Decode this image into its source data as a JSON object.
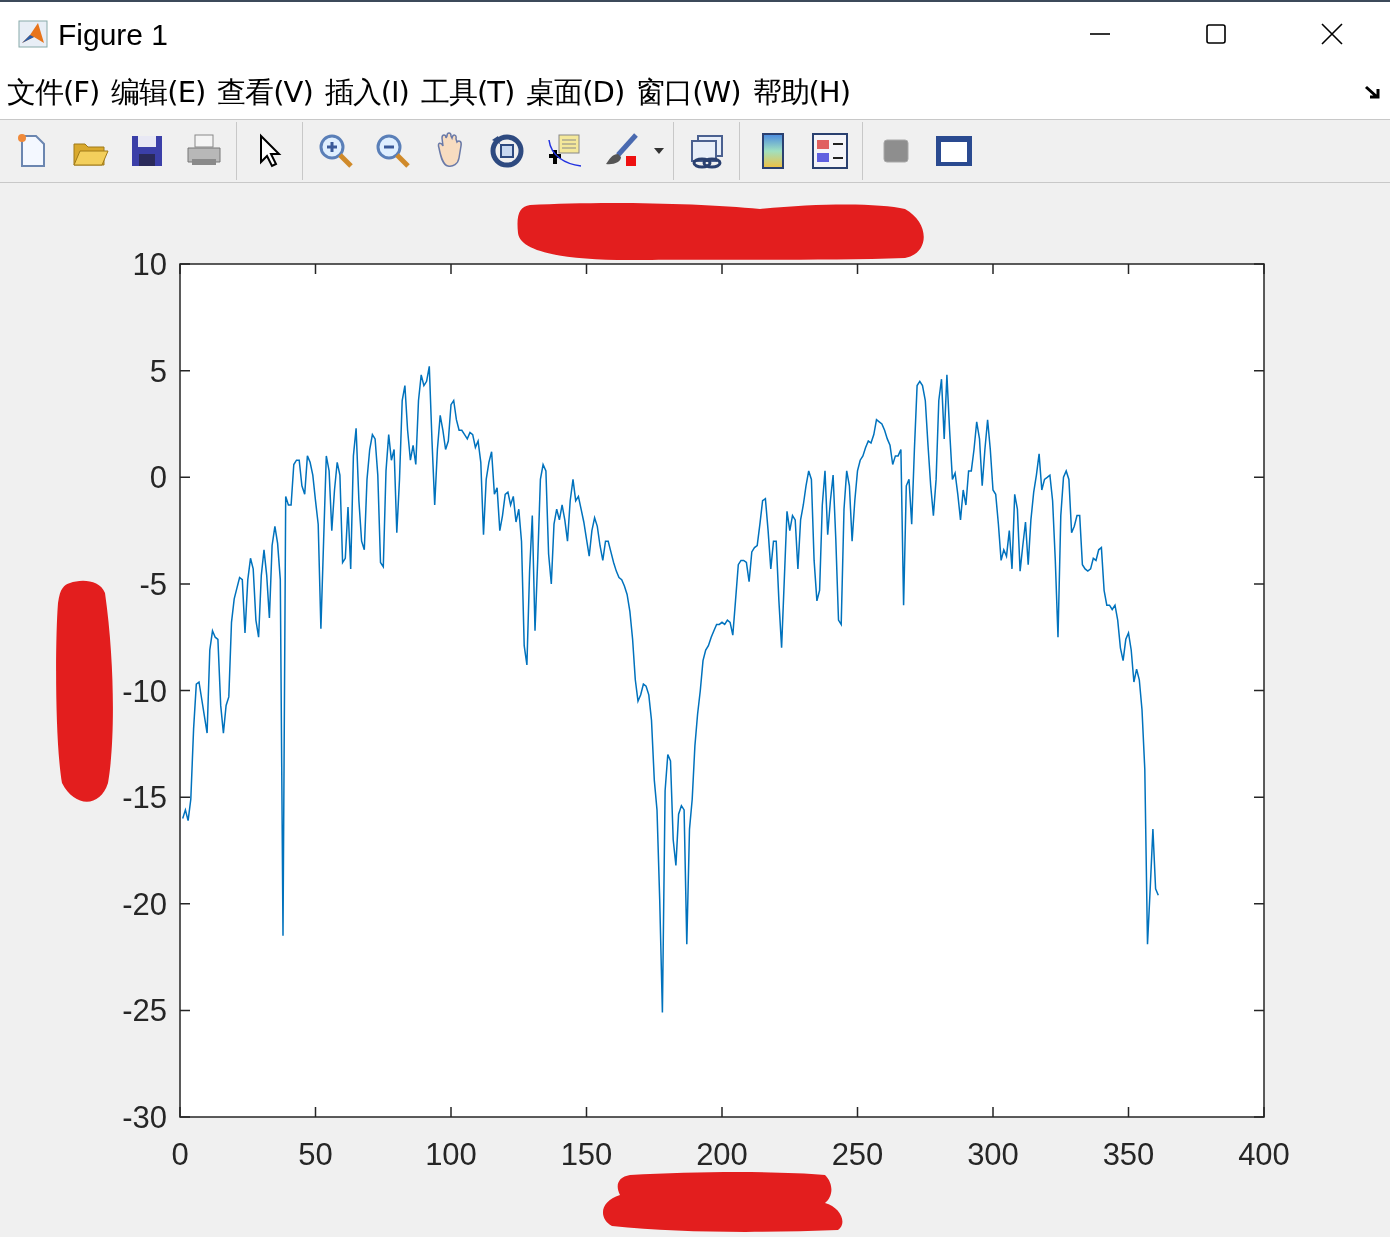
{
  "window": {
    "title": "Figure 1"
  },
  "menu": [
    "文件(F)",
    "编辑(E)",
    "查看(V)",
    "插入(I)",
    "工具(T)",
    "桌面(D)",
    "窗口(W)",
    "帮助(H)"
  ],
  "figure": {
    "chart_data": {
      "type": "line",
      "xlim": [
        0,
        400
      ],
      "ylim": [
        -30,
        10
      ],
      "xticks": [
        0,
        50,
        100,
        150,
        200,
        250,
        300,
        350,
        400
      ],
      "yticks": [
        -30,
        -25,
        -20,
        -15,
        -10,
        -5,
        0,
        5,
        10
      ],
      "x": [
        1,
        2,
        3,
        4,
        5,
        6,
        7,
        8,
        9,
        10,
        11,
        12,
        13,
        14,
        15,
        16,
        17,
        18,
        19,
        20,
        21,
        22,
        23,
        24,
        25,
        26,
        27,
        28,
        29,
        30,
        31,
        32,
        33,
        34,
        35,
        36,
        37,
        38,
        39,
        40,
        41,
        42,
        43,
        44,
        45,
        46,
        47,
        48,
        49,
        50,
        51,
        52,
        53,
        54,
        55,
        56,
        57,
        58,
        59,
        60,
        61,
        62,
        63,
        64,
        65,
        66,
        67,
        68,
        69,
        70,
        71,
        72,
        73,
        74,
        75,
        76,
        77,
        78,
        79,
        80,
        81,
        82,
        83,
        84,
        85,
        86,
        87,
        88,
        89,
        90,
        91,
        92,
        93,
        94,
        95,
        96,
        97,
        98,
        99,
        100,
        101,
        102,
        103,
        104,
        105,
        106,
        107,
        108,
        109,
        110,
        111,
        112,
        113,
        114,
        115,
        116,
        117,
        118,
        119,
        120,
        121,
        122,
        123,
        124,
        125,
        126,
        127,
        128,
        129,
        130,
        131,
        132,
        133,
        134,
        135,
        136,
        137,
        138,
        139,
        140,
        141,
        142,
        143,
        144,
        145,
        146,
        147,
        148,
        149,
        150,
        151,
        152,
        153,
        154,
        155,
        156,
        157,
        158,
        159,
        160,
        161,
        162,
        163,
        164,
        165,
        166,
        167,
        168,
        169,
        170,
        171,
        172,
        173,
        174,
        175,
        176,
        177,
        178,
        179,
        180,
        181,
        182,
        183,
        184,
        185,
        186,
        187,
        188,
        189,
        190,
        191,
        192,
        193,
        194,
        195,
        196,
        197,
        198,
        199,
        200,
        201,
        202,
        203,
        204,
        205,
        206,
        207,
        208,
        209,
        210,
        211,
        212,
        213,
        214,
        215,
        216,
        217,
        218,
        219,
        220,
        221,
        222,
        223,
        224,
        225,
        226,
        227,
        228,
        229,
        230,
        231,
        232,
        233,
        234,
        235,
        236,
        237,
        238,
        239,
        240,
        241,
        242,
        243,
        244,
        245,
        246,
        247,
        248,
        249,
        250,
        251,
        252,
        253,
        254,
        255,
        256,
        257,
        258,
        259,
        260,
        261,
        262,
        263,
        264,
        265,
        266,
        267,
        268,
        269,
        270,
        271,
        272,
        273,
        274,
        275,
        276,
        277,
        278,
        279,
        280,
        281,
        282,
        283,
        284,
        285,
        286,
        287,
        288,
        289,
        290,
        291,
        292,
        293,
        294,
        295,
        296,
        297,
        298,
        299,
        300,
        301,
        302,
        303,
        304,
        305,
        306,
        307,
        308,
        309,
        310,
        311,
        312,
        313,
        314,
        315,
        316,
        317,
        318,
        319,
        320,
        321,
        322,
        323,
        324,
        325,
        326,
        327,
        328,
        329,
        330,
        331,
        332,
        333,
        334,
        335,
        336,
        337,
        338,
        339,
        340,
        341,
        342,
        343,
        344,
        345,
        346,
        347,
        348,
        349,
        350,
        351,
        352,
        353,
        354,
        355,
        356,
        357,
        358,
        359,
        360,
        361
      ],
      "series": [
        {
          "color": "#0072bd",
          "values": [
            -16,
            -15.6,
            -16.1,
            -15.1,
            -11.8,
            -9.7,
            -9.6,
            -10.4,
            -11.2,
            -12,
            -8.1,
            -7.2,
            -7.5,
            -7.6,
            -10.7,
            -12,
            -10.7,
            -10.3,
            -6.8,
            -5.7,
            -5.2,
            -4.7,
            -4.8,
            -7.3,
            -4.8,
            -3.8,
            -4.3,
            -6.7,
            -7.5,
            -4.6,
            -3.4,
            -4.6,
            -6.6,
            -3.2,
            -2.3,
            -3.1,
            -4.8,
            -21.5,
            -0.9,
            -1.3,
            -1.3,
            0.6,
            0.8,
            0.8,
            -0.4,
            -0.8,
            1,
            0.7,
            0.1,
            -1.1,
            -2.2,
            -7.1,
            -3,
            1,
            0.3,
            -2.5,
            -0.6,
            0.7,
            0.1,
            -4,
            -3.8,
            -1.4,
            -4.3,
            1,
            2.3,
            -1.1,
            -3,
            -3.4,
            -0.1,
            1.3,
            2,
            1.8,
            0.1,
            -4,
            -4.2,
            0.3,
            2,
            0.8,
            1.3,
            -2.6,
            -0.1,
            3.6,
            4.3,
            2.2,
            0.8,
            1.5,
            0.6,
            3.6,
            4.8,
            4.3,
            4.5,
            5.2,
            1.7,
            -1.3,
            1.3,
            2.9,
            2.2,
            1.3,
            1.7,
            3.4,
            3.6,
            2.7,
            2.2,
            2.2,
            2,
            1.8,
            2.1,
            2,
            1.4,
            1.7,
            0.7,
            -2.7,
            -0.1,
            0.7,
            1.2,
            -0.8,
            -0.5,
            -2.5,
            -1.8,
            -0.8,
            -0.7,
            -1.3,
            -0.9,
            -2.1,
            -1.5,
            -3,
            -7.9,
            -8.8,
            -4.4,
            -1.8,
            -7.2,
            -3.9,
            -0.1,
            0.6,
            0.3,
            -3.6,
            -5,
            -2.2,
            -1.5,
            -2,
            -1.3,
            -2,
            -3,
            -1.1,
            -0.1,
            -1.1,
            -0.9,
            -1.5,
            -2.1,
            -2.9,
            -3.7,
            -2.5,
            -1.9,
            -2.3,
            -3.2,
            -3.9,
            -3,
            -3,
            -3.5,
            -4,
            -4.4,
            -4.7,
            -4.8,
            -5.1,
            -5.5,
            -6.3,
            -7.6,
            -9.5,
            -10.5,
            -10.2,
            -9.7,
            -9.8,
            -10.2,
            -11.4,
            -14.2,
            -15.6,
            -19.8,
            -25.1,
            -14.7,
            -13,
            -13.3,
            -17,
            -18.2,
            -15.8,
            -15.4,
            -15.6,
            -21.9,
            -16.5,
            -15.1,
            -12.6,
            -11.1,
            -10,
            -8.6,
            -8.1,
            -7.9,
            -7.5,
            -7.2,
            -6.9,
            -6.9,
            -6.8,
            -6.9,
            -6.7,
            -6.8,
            -7.4,
            -5.8,
            -4.1,
            -3.9,
            -3.9,
            -4,
            -4.9,
            -3.5,
            -3.3,
            -3.2,
            -2.2,
            -1.1,
            -1,
            -2.5,
            -4.3,
            -3,
            -3,
            -5.8,
            -8,
            -4.8,
            -1.6,
            -2.5,
            -1.8,
            -2,
            -4.3,
            -2,
            -1.3,
            -0.4,
            0.3,
            -0.1,
            -3.9,
            -5.8,
            -5.3,
            -1.3,
            0.3,
            -2.7,
            -1.1,
            0.1,
            -2.9,
            -6.7,
            -6.9,
            -1.5,
            0.3,
            -0.4,
            -3,
            -1.1,
            0.3,
            0.8,
            1,
            1.4,
            1.7,
            1.6,
            2,
            2.7,
            2.6,
            2.5,
            2.2,
            1.8,
            1.5,
            0.6,
            1,
            1,
            1.3,
            -6,
            -0.4,
            -0.1,
            -2.2,
            1.3,
            4.3,
            4.5,
            4.3,
            3.6,
            1.5,
            -0.4,
            -1.8,
            -0.1,
            3.6,
            4.6,
            1.8,
            4.8,
            2.2,
            -0.1,
            0.2,
            -0.8,
            -2,
            -0.6,
            -1.3,
            0.3,
            0.3,
            1.3,
            2.6,
            1.8,
            -0.4,
            1.3,
            2.7,
            1.3,
            -0.6,
            -0.8,
            -2.2,
            -3.9,
            -3.4,
            -3.7,
            -2.5,
            -4.3,
            -0.8,
            -1.5,
            -4.4,
            -3.2,
            -2.1,
            -4.1,
            -2,
            -0.7,
            0.1,
            1.1,
            -0.6,
            -0.1,
            0,
            0.1,
            -1.1,
            -3.9,
            -7.5,
            -1.8,
            0,
            0.3,
            -0.1,
            -2.6,
            -2.3,
            -1.8,
            -1.8,
            -4.1,
            -4.3,
            -4.4,
            -4.3,
            -3.8,
            -3.9,
            -3.4,
            -3.3,
            -5.3,
            -6,
            -6,
            -6.2,
            -6,
            -6.7,
            -8,
            -8.6,
            -7.6,
            -7.3,
            -8.1,
            -9.6,
            -9,
            -9.5,
            -10.9,
            -13.7,
            -21.9,
            -19.3,
            -16.5,
            -19.3,
            -19.6
          ]
        }
      ]
    }
  }
}
